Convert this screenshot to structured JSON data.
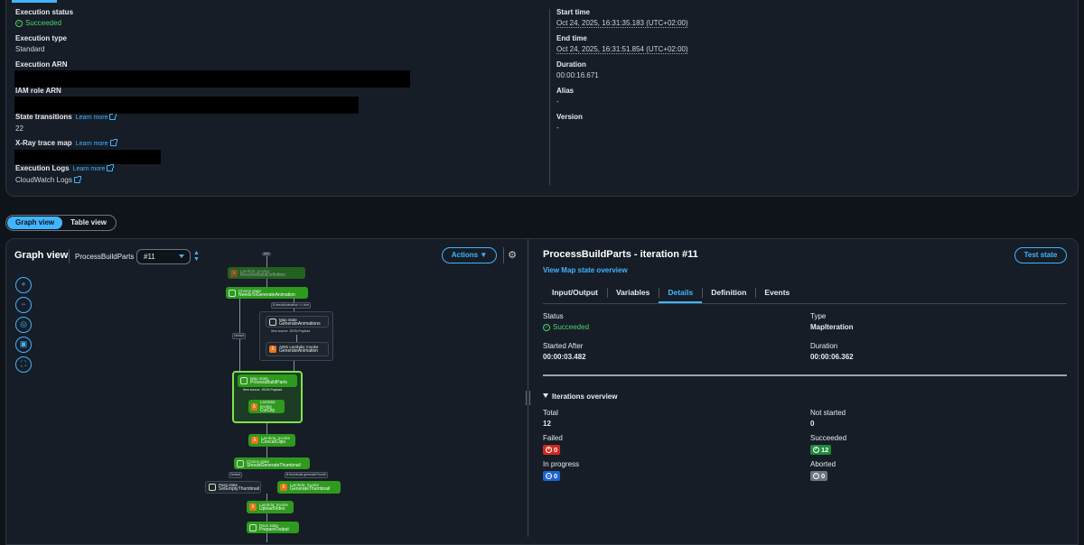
{
  "execution": {
    "status_label": "Execution status",
    "status_value": "Succeeded",
    "type_label": "Execution type",
    "type_value": "Standard",
    "arn_label": "Execution ARN",
    "iam_label": "IAM role ARN",
    "transitions_label": "State transitions",
    "transitions_link": "Learn more",
    "transitions_value": "22",
    "xray_label": "X-Ray trace map",
    "xray_link": "Learn more",
    "logs_label": "Execution Logs",
    "logs_link": "Learn more",
    "logs_value": "CloudWatch Logs",
    "start_label": "Start time",
    "start_value": "Oct 24, 2025, 16:31:35.183 (UTC+02:00)",
    "end_label": "End time",
    "end_value": "Oct 24, 2025, 16:31:51.854 (UTC+02:00)",
    "duration_label": "Duration",
    "duration_value": "00:00:16.671",
    "alias_label": "Alias",
    "alias_value": "-",
    "version_label": "Version",
    "version_value": "-"
  },
  "view_toggle": {
    "graph": "Graph view",
    "table": "Table view"
  },
  "graph": {
    "title": "Graph view",
    "subtitle": "ProcessBuildParts",
    "iteration_select": "#11",
    "actions_label": "Actions",
    "nodes": {
      "start": "Start",
      "n1_type": "Lambda: Invoke",
      "n1": "ResolveBuildDefinition",
      "n2_type": "Choice state",
      "n2": "NeedsToGenerateAnimation",
      "e_default": "Default",
      "e_needs": "$.needsAnimation == true",
      "p_type": "Map state",
      "p_title": "GenerateAnimations",
      "p_sub": "Item source: JSON Payload",
      "n3_type": "AWS Lambda: Invoke",
      "n3": "GenerateAnimation",
      "m_type": "Map state",
      "m_title": "ProcessBuildParts",
      "m_sub": "Item source: JSON Payload",
      "n4_type": "Lambda: Invoke",
      "n4": "CutClip",
      "n5_type": "Lambda: Invoke",
      "n5": "ConcatClips",
      "n6_type": "Choice state",
      "n6": "ShouldGenerateThumbnail",
      "e_default2": "Default",
      "e_thumb": "$.thumbnail.generateThumb",
      "n7_type": "Pass state",
      "n7": "SetEmptyThumbnail",
      "n8_type": "Lambda: Invoke",
      "n8": "GenerateThumbnail",
      "n9_type": "Lambda: Invoke",
      "n9": "UploadVideo",
      "n10_type": "Pass state",
      "n10": "PrepareOutput"
    }
  },
  "detail": {
    "title": "ProcessBuildParts - iteration #11",
    "test_state": "Test state",
    "map_link": "View Map state overview",
    "tabs": [
      "Input/Output",
      "Variables",
      "Details",
      "Definition",
      "Events"
    ],
    "status_label": "Status",
    "status_value": "Succeeded",
    "type_label": "Type",
    "type_value": "MapIteration",
    "started_label": "Started After",
    "started_value": "00:00:03.482",
    "duration_label": "Duration",
    "duration_value": "00:00:06.362",
    "iter_title": "Iterations overview",
    "total_label": "Total",
    "total_value": "12",
    "not_started_label": "Not started",
    "not_started_value": "0",
    "failed_label": "Failed",
    "failed_value": "0",
    "succeeded_label": "Succeeded",
    "succeeded_value": "12",
    "in_progress_label": "In progress",
    "in_progress_value": "0",
    "aborted_label": "Aborted",
    "aborted_value": "0"
  },
  "colors": {
    "accent": "#42b4ff",
    "success": "#4fd16e",
    "node_green": "#2e9a1e",
    "danger": "#d12a1f"
  }
}
